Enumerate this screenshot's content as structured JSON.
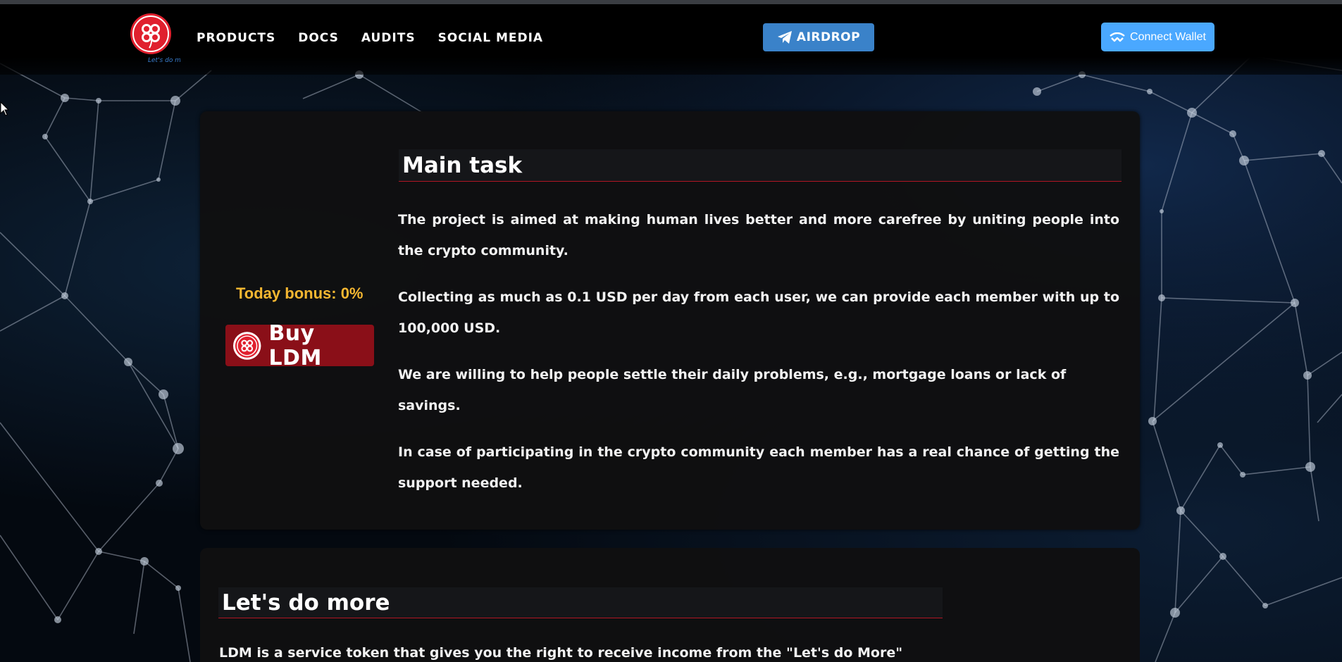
{
  "header": {
    "logo_tagline": "Let's do more",
    "nav": [
      "PRODUCTS",
      "DOCS",
      "AUDITS",
      "SOCIAL MEDIA"
    ],
    "airdrop_label": "AIRDROP",
    "connect_wallet_label": "Connect Wallet"
  },
  "sidebar": {
    "bonus_text": "Today bonus: 0%",
    "buy_label": "Buy LDM"
  },
  "main_task": {
    "title": "Main task",
    "paragraphs": [
      "The project is aimed at making human lives better and more carefree by uniting people into the crypto community.",
      "Collecting as much as 0.1 USD per day from each user, we can provide each member with up to 100,000 USD.",
      "We are willing to help people settle their daily problems, e.g., mortgage loans or lack of savings.",
      "In case of participating in the crypto community each member has a real chance of getting the support needed."
    ]
  },
  "lets_do_more": {
    "title": "Let's do more",
    "intro": "LDM is a service token that gives you the right to receive income from the \"Let's do More\""
  },
  "colors": {
    "accent_red": "#8a0f18",
    "bonus_gold": "#f5b731",
    "airdrop_blue": "#3a82c9",
    "wallet_blue": "#4aa8ff"
  }
}
